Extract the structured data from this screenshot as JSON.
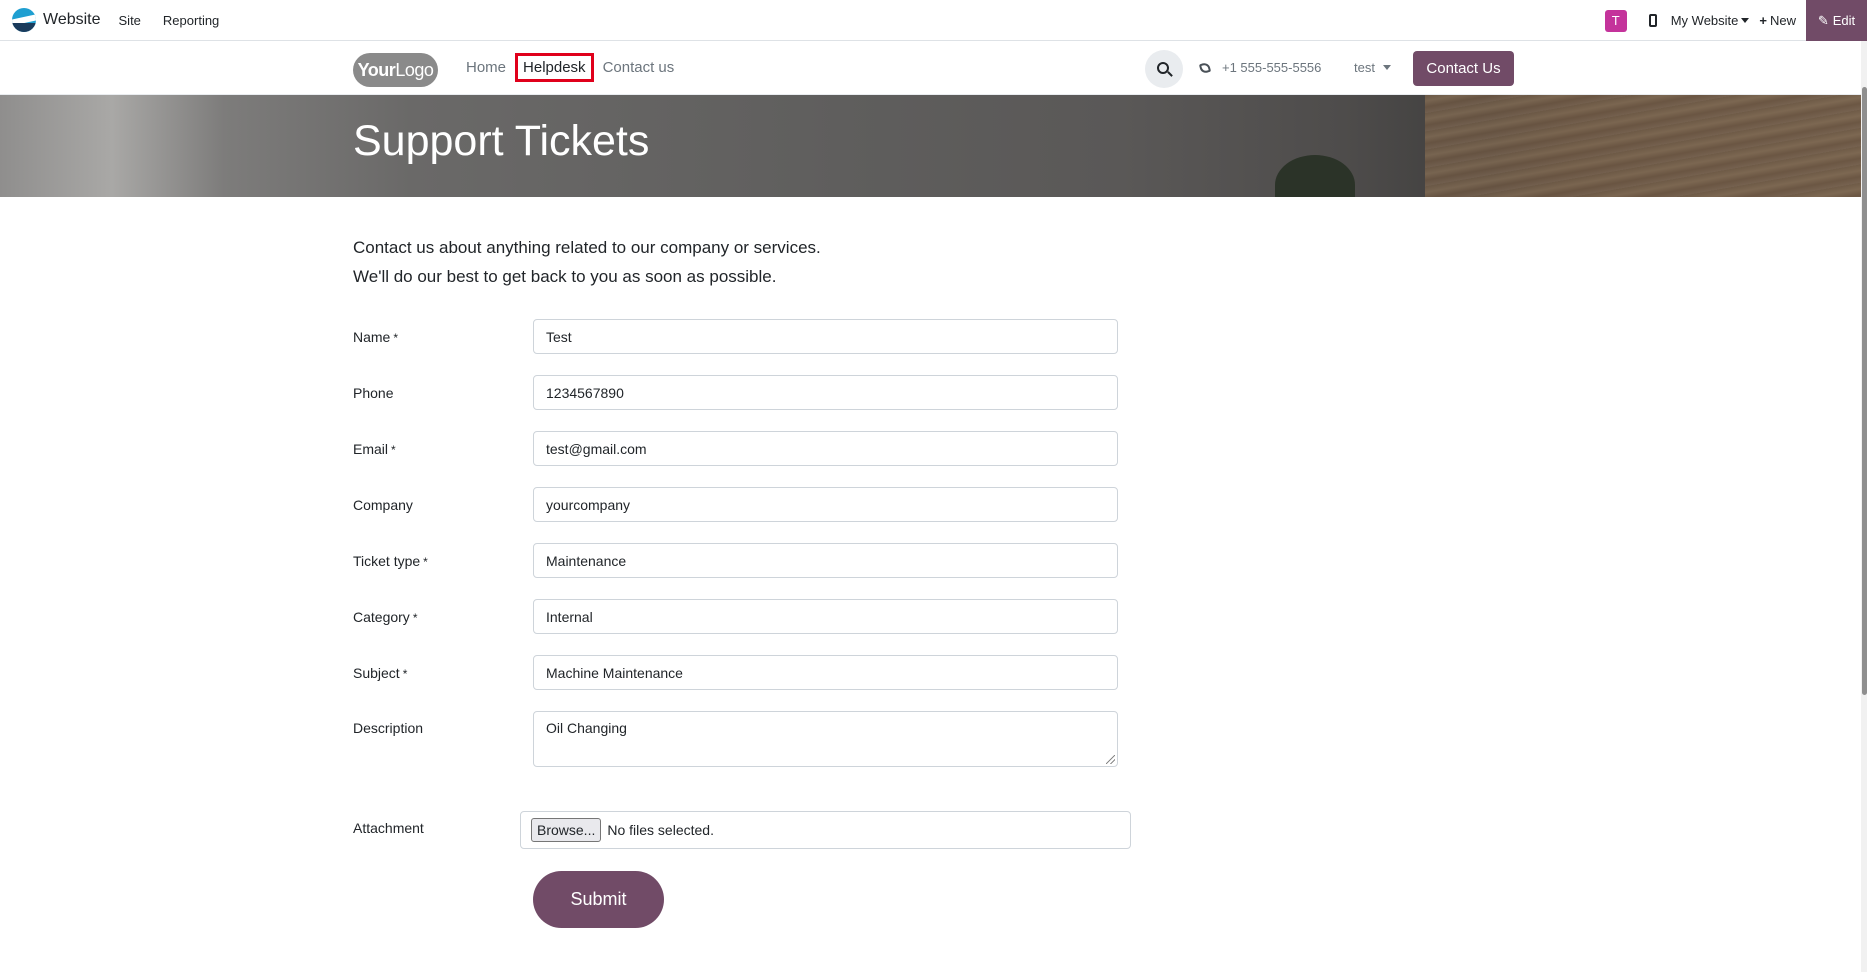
{
  "admin_bar": {
    "app_name": "Website",
    "menu": [
      "Site",
      "Reporting"
    ],
    "avatar_letter": "T",
    "website_selector": "My Website",
    "new_label": "New",
    "edit_label": "Edit"
  },
  "header": {
    "logo_text_bold": "Your",
    "logo_text": "Logo",
    "nav": [
      "Home",
      "Helpdesk",
      "Contact us"
    ],
    "phone": "+1 555-555-5556",
    "language": "test",
    "contact_button": "Contact Us"
  },
  "banner": {
    "title": "Support Tickets"
  },
  "intro": {
    "line1": "Contact us about anything related to our company or services.",
    "line2": "We'll do our best to get back to you as soon as possible."
  },
  "form": {
    "fields": [
      {
        "label": "Name",
        "required": "*",
        "value": "Test"
      },
      {
        "label": "Phone",
        "required": "",
        "value": "1234567890"
      },
      {
        "label": "Email",
        "required": "*",
        "value": "test@gmail.com"
      },
      {
        "label": "Company",
        "required": "",
        "value": "yourcompany"
      },
      {
        "label": "Ticket type",
        "required": "*",
        "value": "Maintenance"
      },
      {
        "label": "Category",
        "required": "*",
        "value": "Internal"
      },
      {
        "label": "Subject",
        "required": "*",
        "value": "Machine Maintenance"
      },
      {
        "label": "Description",
        "required": "",
        "value": "Oil Changing"
      }
    ],
    "attachment_label": "Attachment",
    "browse_label": "Browse...",
    "no_files": "No files selected.",
    "submit_label": "Submit"
  },
  "colors": {
    "brand": "#714b67",
    "avatar": "#c4339b",
    "highlight": "#e0001b"
  }
}
